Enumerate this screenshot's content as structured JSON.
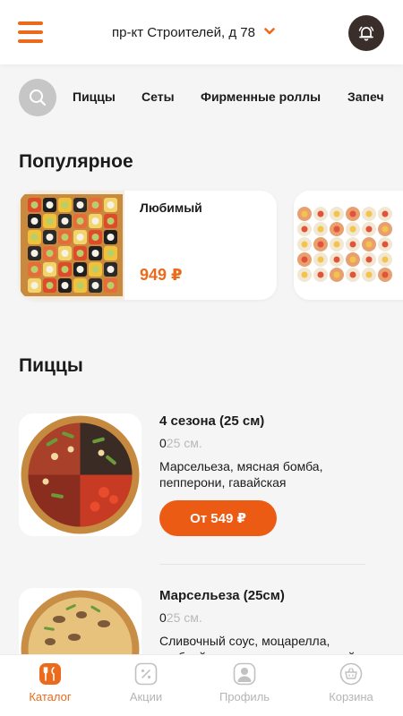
{
  "header": {
    "address": "пр-кт Строителей, д 78"
  },
  "categories": [
    "Пиццы",
    "Сеты",
    "Фирменные роллы",
    "Запеч"
  ],
  "popular": {
    "title": "Популярное",
    "items": [
      {
        "name": "Любимый",
        "price": "949 ₽"
      }
    ]
  },
  "pizzas": {
    "title": "Пиццы",
    "items": [
      {
        "name": "4 сезона (25 см)",
        "weight_prefix": "0",
        "weight_rest": "25 см.",
        "description": "Марсельеза, мясная бомба, пепперони, гавайская",
        "price_label": "От 549 ₽"
      },
      {
        "name": "Марсельеза (25см)",
        "weight_prefix": "0",
        "weight_rest": "25 см.",
        "description": "Сливочный соус, моцарелла, грибной жульен, курица, зеленый"
      }
    ]
  },
  "tabs": [
    {
      "label": "Каталог",
      "icon": "fork-knife-icon",
      "active": true
    },
    {
      "label": "Акции",
      "icon": "percent-icon",
      "active": false
    },
    {
      "label": "Профиль",
      "icon": "profile-icon",
      "active": false
    },
    {
      "label": "Корзина",
      "icon": "basket-icon",
      "active": false
    }
  ],
  "colors": {
    "accent": "#ec6a1c",
    "button": "#ec5b13",
    "bell_bg": "#3a2e2b",
    "background": "#f5f5f5"
  }
}
